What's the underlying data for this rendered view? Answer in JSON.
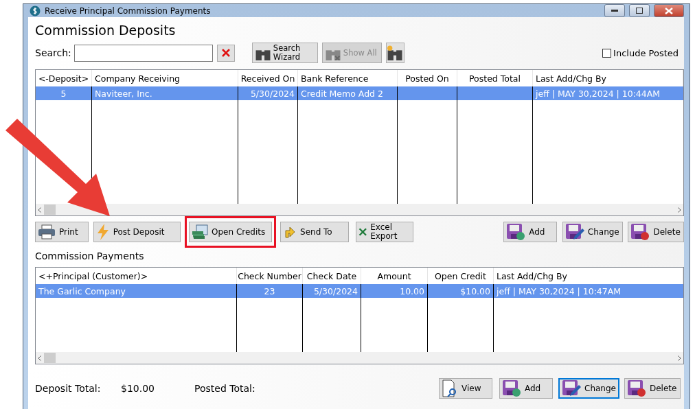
{
  "window": {
    "title": "Receive Principal Commission Payments"
  },
  "heading": "Commission Deposits",
  "search": {
    "label": "Search:"
  },
  "toolbar": [
    {
      "kind": "wizard",
      "label": "Search Wizard",
      "disabled": false
    },
    {
      "kind": "showall",
      "label": "Show All",
      "disabled": true
    },
    {
      "kind": "new",
      "disabled": false
    }
  ],
  "include_posted": {
    "label": "Include Posted",
    "checked": false
  },
  "deposits": {
    "columns": [
      "<-Deposit>",
      "Company Receiving",
      "Received On",
      "Bank Reference",
      "Posted On",
      "Posted Total",
      "Last Add/Chg By"
    ],
    "rows": [
      {
        "selected": true,
        "cells": [
          "5",
          "Naviteer, Inc.",
          "5/30/2024",
          "Credit Memo Add 2",
          "",
          "",
          "jeff | MAY 30,2024 | 10:44AM"
        ]
      }
    ]
  },
  "deposit_actions": [
    {
      "kind": "print",
      "label": "Print",
      "highlighted": false
    },
    {
      "kind": "post",
      "label": "Post Deposit",
      "highlighted": false
    },
    {
      "kind": "credits",
      "label": "Open Credits",
      "highlighted": true
    },
    {
      "kind": "send",
      "label": "Send To",
      "highlighted": false
    },
    {
      "kind": "excel",
      "label": "Excel Export",
      "highlighted": false
    },
    {
      "kind": "add",
      "label": "Add",
      "highlighted": false
    },
    {
      "kind": "change",
      "label": "Change",
      "highlighted": false
    },
    {
      "kind": "delete",
      "label": "Delete",
      "highlighted": false
    }
  ],
  "payments_heading": "Commission Payments",
  "payments": {
    "columns": [
      "<+Principal (Customer)>",
      "Check Number",
      "Check Date",
      "Amount",
      "Open Credit",
      "Last Add/Chg By"
    ],
    "rows": [
      {
        "selected": true,
        "cells": [
          "The Garlic Company",
          "23",
          "5/30/2024",
          "10.00",
          "$10.00",
          "jeff | MAY 30,2024 | 10:47AM"
        ]
      }
    ]
  },
  "footer": {
    "deposit_total_label": "Deposit Total:",
    "deposit_total": "$10.00",
    "posted_total_label": "Posted Total:"
  },
  "payment_actions": [
    {
      "kind": "view",
      "label": "View",
      "focused": false
    },
    {
      "kind": "add",
      "label": "Add",
      "focused": false
    },
    {
      "kind": "change",
      "label": "Change",
      "focused": true
    },
    {
      "kind": "delete",
      "label": "Delete",
      "focused": false
    }
  ]
}
